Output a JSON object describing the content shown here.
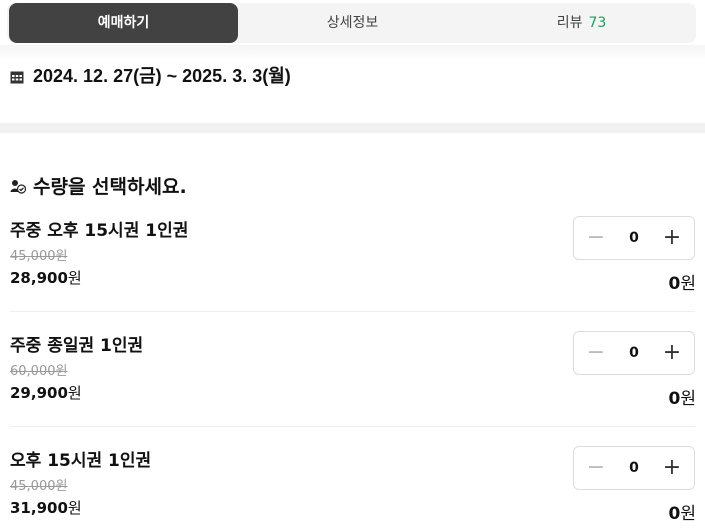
{
  "tabs": [
    {
      "label": "예매하기",
      "active": true
    },
    {
      "label": "상세정보",
      "active": false
    },
    {
      "label": "리뷰",
      "count": "73",
      "active": false
    }
  ],
  "date_range": "2024. 12. 27(금) ~ 2025. 3. 3(월)",
  "section_title": "수량을 선택하세요.",
  "currency_unit": "원",
  "items": [
    {
      "name": "주중 오후 15시권 1인권",
      "original_price": "45,000원",
      "price": "28,900",
      "quantity": "0",
      "total": "0"
    },
    {
      "name": "주중 종일권 1인권",
      "original_price": "60,000원",
      "price": "29,900",
      "quantity": "0",
      "total": "0"
    },
    {
      "name": "오후 15시권 1인권",
      "original_price": "45,000원",
      "price": "31,900",
      "quantity": "0",
      "total": "0"
    }
  ],
  "stepper": {
    "minus": "−",
    "plus": "+"
  },
  "colors": {
    "active_tab_bg": "#424242",
    "review_count": "#1aa05b",
    "strike_price": "#999999"
  },
  "icons": {
    "date": "calendar-icon",
    "section": "people-icon"
  }
}
